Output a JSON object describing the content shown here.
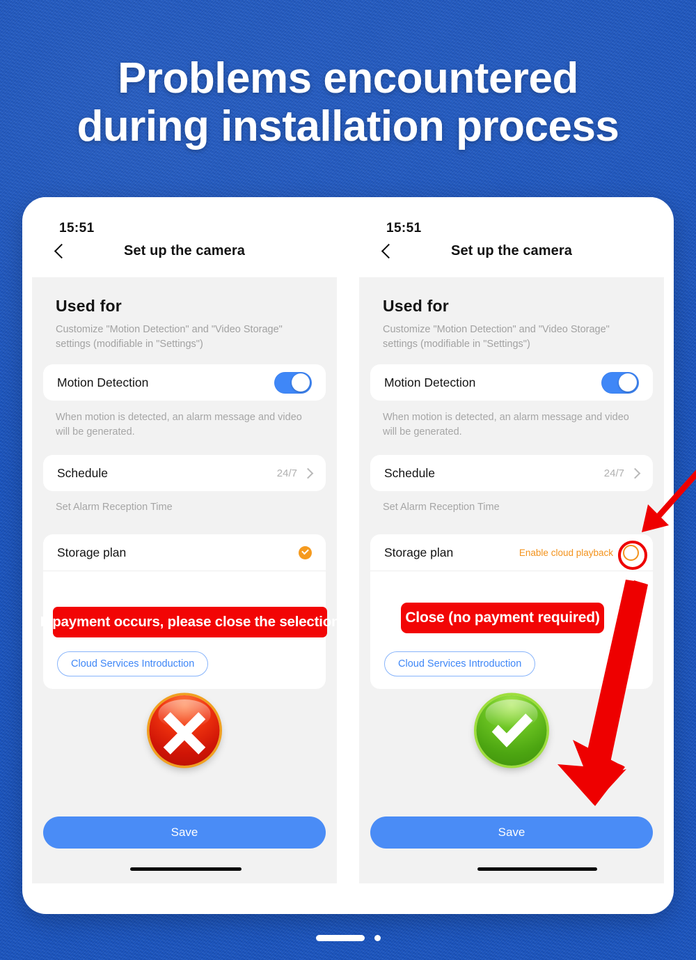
{
  "background": {
    "color": "#1A55C2"
  },
  "headline": {
    "line1": "Problems encountered",
    "line2": "during installation process"
  },
  "phones": [
    {
      "id": "left",
      "status_time": "15:51",
      "nav_title": "Set up  the camera",
      "back_icon": "chevron-left-icon",
      "section": {
        "title": "Used for",
        "description": "Customize \"Motion Detection\" and \"Video Storage\" settings (modifiable in \"Settings\")"
      },
      "motion_detection": {
        "label": "Motion Detection",
        "toggle_state": "on",
        "helper": "When motion is detected, an alarm message and video will be generated."
      },
      "schedule": {
        "label": "Schedule",
        "value": "24/7",
        "helper": "Set Alarm Reception Time"
      },
      "storage_plan": {
        "label": "Storage plan",
        "status_label": "",
        "indicator": "check-filled-orange",
        "indicator_color": "#F59A1E",
        "cloud_button": "Cloud Services Introduction"
      },
      "callout": {
        "text": "If payment occurs, please close the selection",
        "color": "#F20505"
      },
      "result_badge": {
        "icon": "cross-mark-icon",
        "color": "#E02000"
      },
      "save_label": "Save",
      "save_color": "#4A8CF6"
    },
    {
      "id": "right",
      "status_time": "15:51",
      "nav_title": "Set up  the camera",
      "back_icon": "chevron-left-icon",
      "section": {
        "title": "Used for",
        "description": "Customize \"Motion Detection\" and \"Video Storage\" settings (modifiable in \"Settings\")"
      },
      "motion_detection": {
        "label": "Motion Detection",
        "toggle_state": "on",
        "helper": "When motion is detected, an alarm message and video will be generated."
      },
      "schedule": {
        "label": "Schedule",
        "value": "24/7",
        "helper": "Set Alarm Reception Time"
      },
      "storage_plan": {
        "label": "Storage plan",
        "status_label": "Enable cloud playback",
        "indicator": "radio-empty-orange",
        "indicator_color": "#F3921B",
        "cloud_button": "Cloud Services Introduction"
      },
      "callout": {
        "text": "Close (no payment required)",
        "color": "#F20505"
      },
      "result_badge": {
        "icon": "check-mark-icon",
        "color": "#5BB118"
      },
      "save_label": "Save",
      "save_color": "#4A8CF6"
    }
  ],
  "annotations": {
    "arrow_to_toggle": "arrow-pointing-to-cloud-playback-toggle",
    "arrow_to_save": "arrow-pointing-to-save-button",
    "highlight_circle": "circle-highlight-around-radio",
    "arrow_color": "#EE0000"
  },
  "page_indicator": {
    "pill": "active-page",
    "dot": "next-page"
  }
}
